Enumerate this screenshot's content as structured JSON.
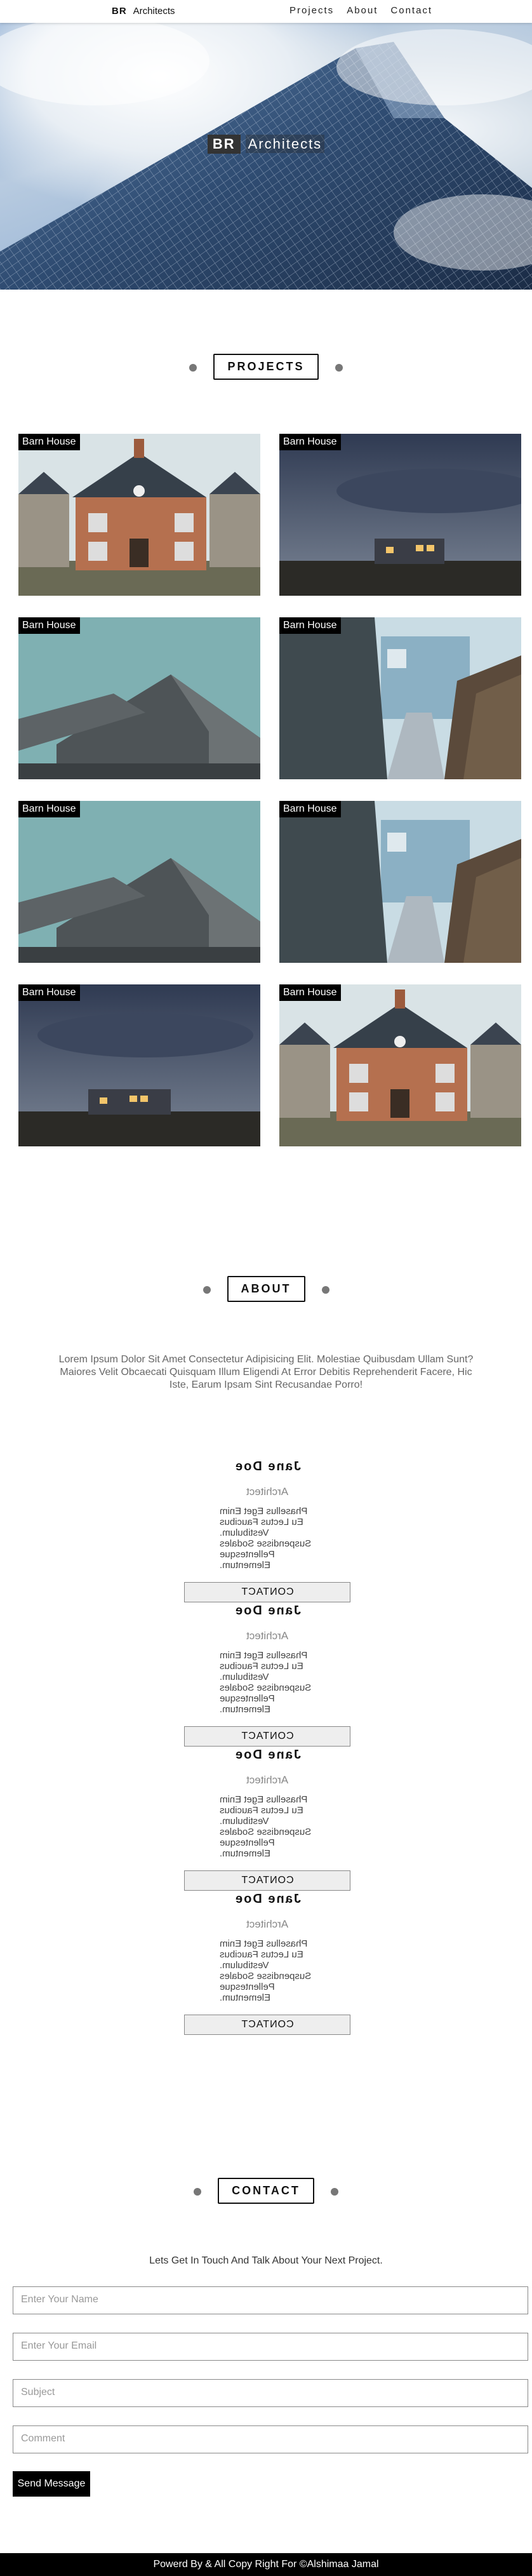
{
  "nav": {
    "brand_abbr": "BR",
    "brand_name": "Architects",
    "links": [
      "Projects",
      "About",
      "Contact"
    ]
  },
  "hero": {
    "abbr": "BR",
    "name": "Architects"
  },
  "projects": {
    "heading": "PROJECTS",
    "items": [
      {
        "label": "Barn House",
        "image": "brick-house"
      },
      {
        "label": "Barn House",
        "image": "night-house"
      },
      {
        "label": "Barn House",
        "image": "grey-barn"
      },
      {
        "label": "Barn House",
        "image": "blue-house-path"
      },
      {
        "label": "Barn House",
        "image": "grey-barn"
      },
      {
        "label": "Barn House",
        "image": "blue-house-path"
      },
      {
        "label": "Barn House",
        "image": "night-house"
      },
      {
        "label": "Barn House",
        "image": "brick-house"
      }
    ]
  },
  "about": {
    "heading": "ABOUT",
    "text": "Lorem Ipsum Dolor Sit Amet Consectetur Adipisicing Elit. Molestiae Quibusdam Ullam Sunt? Maiores Velit Obcaecati Quisquam Illum Eligendi At Error Debitis Reprehenderit Facere, Hic Iste, Earum Ipsam Sint Recusandae Porro!",
    "team": [
      {
        "name": "Jane Doe",
        "role": "Architect",
        "desc": "Phasellus Eget Enim Eu Lectus Faucibus Vestibulum. Suspendisse Sodales Pellentesque Elementum.",
        "button": "CONTACT"
      },
      {
        "name": "Jane Doe",
        "role": "Architect",
        "desc": "Phasellus Eget Enim Eu Lectus Faucibus Vestibulum. Suspendisse Sodales Pellentesque Elementum.",
        "button": "CONTACT"
      },
      {
        "name": "Jane Doe",
        "role": "Architect",
        "desc": "Phasellus Eget Enim Eu Lectus Faucibus Vestibulum. Suspendisse Sodales Pellentesque Elementum.",
        "button": "CONTACT"
      },
      {
        "name": "Jane Doe",
        "role": "Architect",
        "desc": "Phasellus Eget Enim Eu Lectus Faucibus Vestibulum. Suspendisse Sodales Pellentesque Elementum.",
        "button": "CONTACT"
      }
    ]
  },
  "contact": {
    "heading": "CONTACT",
    "intro": "Lets Get In Touch And Talk About Your Next Project.",
    "name_placeholder": "Enter Your Name",
    "email_placeholder": "Enter Your Email",
    "subject_placeholder": "Subject",
    "comment_placeholder": "Comment",
    "send_label": "Send Message"
  },
  "footer": {
    "text": "Powerd By & All Copy Right For ©Alshimaa Jamal"
  }
}
